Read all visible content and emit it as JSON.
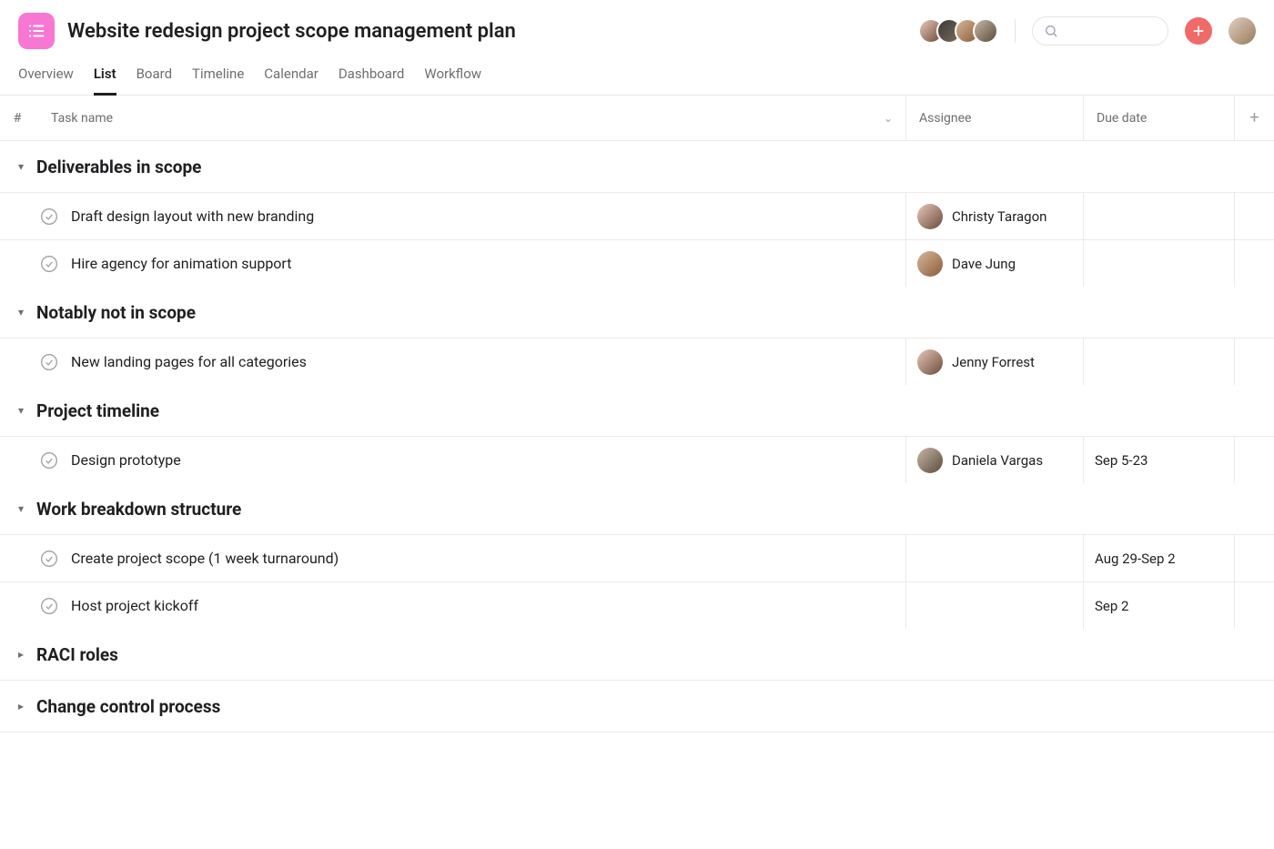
{
  "project": {
    "title": "Website redesign project scope management plan"
  },
  "tabs": [
    {
      "label": "Overview",
      "active": false
    },
    {
      "label": "List",
      "active": true
    },
    {
      "label": "Board",
      "active": false
    },
    {
      "label": "Timeline",
      "active": false
    },
    {
      "label": "Calendar",
      "active": false
    },
    {
      "label": "Dashboard",
      "active": false
    },
    {
      "label": "Workflow",
      "active": false
    }
  ],
  "columns": {
    "num": "#",
    "task": "Task name",
    "assignee": "Assignee",
    "due": "Due date"
  },
  "sections": [
    {
      "title": "Deliverables in scope",
      "expanded": true,
      "tasks": [
        {
          "name": "Draft design layout with new branding",
          "assignee": "Christy Taragon",
          "due": ""
        },
        {
          "name": "Hire agency for animation support",
          "assignee": "Dave Jung",
          "due": ""
        }
      ]
    },
    {
      "title": "Notably not in scope",
      "expanded": true,
      "tasks": [
        {
          "name": "New landing pages for all categories",
          "assignee": "Jenny Forrest",
          "due": ""
        }
      ]
    },
    {
      "title": "Project timeline",
      "expanded": true,
      "tasks": [
        {
          "name": "Design prototype",
          "assignee": "Daniela Vargas",
          "due": "Sep 5-23"
        }
      ]
    },
    {
      "title": "Work breakdown structure",
      "expanded": true,
      "tasks": [
        {
          "name": "Create project scope (1 week turnaround)",
          "assignee": "",
          "due": "Aug 29-Sep 2"
        },
        {
          "name": "Host project kickoff",
          "assignee": "",
          "due": "Sep 2"
        }
      ]
    },
    {
      "title": "RACI roles",
      "expanded": false,
      "tasks": []
    },
    {
      "title": "Change control process",
      "expanded": false,
      "tasks": []
    }
  ],
  "header_avatars": 4
}
